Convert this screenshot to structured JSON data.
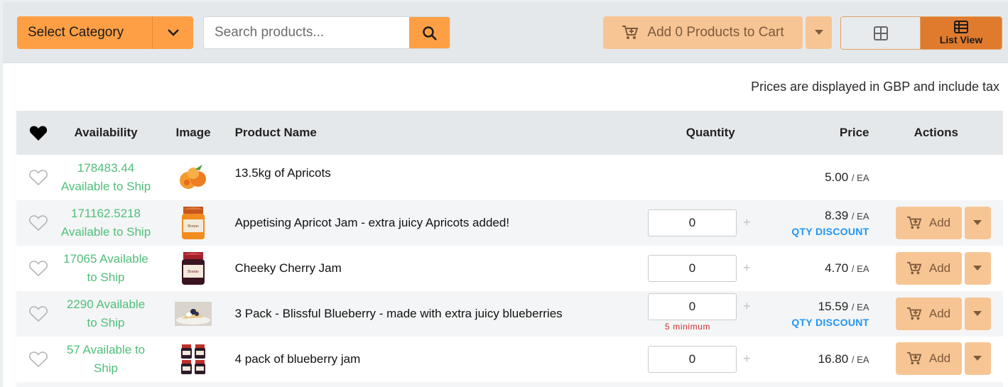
{
  "toolbar": {
    "category_label": "Select Category",
    "search_placeholder": "Search products...",
    "cart_label": "Add 0 Products to Cart",
    "list_view_label": "List View"
  },
  "price_note": "Prices are displayed in GBP and include tax",
  "table": {
    "headers": {
      "availability": "Availability",
      "image": "Image",
      "product_name": "Product Name",
      "quantity": "Quantity",
      "price": "Price",
      "actions": "Actions"
    },
    "rows": [
      {
        "availability": "178483.44 Available to Ship",
        "name": "13.5kg of Apricots",
        "quantity": "",
        "price": "5.00",
        "unit": "/ EA",
        "discount": "",
        "min_note": "",
        "add_label": "",
        "image": "apricots"
      },
      {
        "availability": "171162.5218 Available to Ship",
        "name": "Appetising Apricot Jam - extra juicy Apricots added!",
        "quantity": "0",
        "price": "8.39",
        "unit": "/ EA",
        "discount": "QTY DISCOUNT",
        "min_note": "",
        "add_label": "Add",
        "image": "apricot-jam"
      },
      {
        "availability": "17065 Available to Ship",
        "name": "Cheeky Cherry Jam",
        "quantity": "0",
        "price": "4.70",
        "unit": "/ EA",
        "discount": "",
        "min_note": "",
        "add_label": "Add",
        "image": "cherry-jam"
      },
      {
        "availability": "2290 Available to Ship",
        "name": "3 Pack - Blissful Blueberry - made with extra juicy blueberries",
        "quantity": "0",
        "price": "15.59",
        "unit": "/ EA",
        "discount": "QTY DISCOUNT",
        "min_note": "5 minimum",
        "add_label": "Add",
        "image": "blueberry-cake"
      },
      {
        "availability": "57 Available to Ship",
        "name": "4 pack of blueberry jam",
        "quantity": "0",
        "price": "16.80",
        "unit": "/ EA",
        "discount": "",
        "min_note": "",
        "add_label": "Add",
        "image": "jam-4pack"
      }
    ]
  },
  "colors": {
    "accent": "#ff9f45",
    "accent_disabled": "#f7c594",
    "available": "#4fbf7a",
    "discount": "#2196f3",
    "warning": "#d32f2f"
  }
}
